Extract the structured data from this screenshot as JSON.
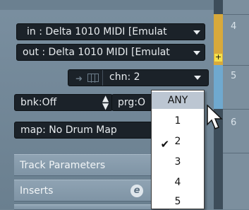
{
  "inspector": {
    "in_label": "in : ",
    "in_value": "Delta 1010 MIDI [Emulat",
    "out_label": "out : ",
    "out_value": "Delta 1010 MIDI [Emulat",
    "chn_label": "chn: ",
    "chn_value": "2",
    "bank_label": "bnk:",
    "bank_value": "Off",
    "prg_label": "prg:",
    "prg_value": "O",
    "map_label": "map: ",
    "map_value": "No Drum Map",
    "sections": [
      "Track Parameters",
      "Inserts"
    ],
    "inserts_icon_glyph": "e"
  },
  "track_list": {
    "numbers": [
      "4",
      "5",
      "6"
    ],
    "color_accent": "#d8a93b",
    "color_blue": "#6fa9cf"
  },
  "dropdown": {
    "options": [
      "ANY",
      "1",
      "2",
      "3",
      "4",
      "5"
    ],
    "highlighted": "ANY",
    "checked": "2",
    "check_glyph": "✔"
  },
  "plus_glyph": "+"
}
